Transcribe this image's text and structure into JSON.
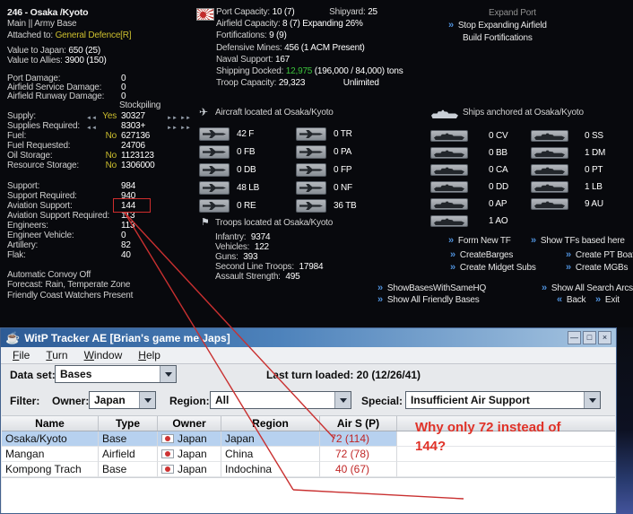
{
  "game": {
    "header": {
      "title": "246 - Osaka /Kyoto",
      "subtitle": "Main || Army Base",
      "attached_label": "Attached to:",
      "attached_value": "General Defence[R]",
      "value_japan_label": "Value to Japan:",
      "value_japan": "650 (25)",
      "value_allies_label": "Value to Allies:",
      "value_allies": "3900 (150)"
    },
    "damage": {
      "stockpiling_label": "Stockpiling",
      "rows": [
        {
          "label": "Port Damage:",
          "value": "0"
        },
        {
          "label": "Airfield Service Damage:",
          "value": "0"
        },
        {
          "label": "Airfield Runway Damage:",
          "value": "0"
        }
      ]
    },
    "supply": {
      "rows": [
        {
          "label": "Supply:",
          "flag": "Yes",
          "value": "30327"
        },
        {
          "label": "Supplies Required:",
          "flag": "",
          "value": "8303+"
        },
        {
          "label": "Fuel:",
          "flag": "No",
          "value": "627136"
        },
        {
          "label": "Fuel Requested:",
          "flag": "",
          "value": "24706"
        },
        {
          "label": "Oil Storage:",
          "flag": "No",
          "value": "1123123"
        },
        {
          "label": "Resource Storage:",
          "flag": "No",
          "value": "1306000"
        }
      ]
    },
    "support": {
      "rows": [
        {
          "label": "Support:",
          "value": "984"
        },
        {
          "label": "Support Required:",
          "value": "940"
        },
        {
          "label": "Aviation Support:",
          "value": "144"
        },
        {
          "label": "Aviation Support Required:",
          "value": "113"
        },
        {
          "label": "Engineers:",
          "value": "113"
        },
        {
          "label": "Engineer Vehicle:",
          "value": "0"
        },
        {
          "label": "Artillery:",
          "value": "82"
        },
        {
          "label": "Flak:",
          "value": "40"
        }
      ]
    },
    "footer_lines": [
      "Automatic Convoy Off",
      "Forecast: Rain, Temperate Zone",
      "Friendly Coast Watchers Present"
    ],
    "port": {
      "port_capacity_label": "Port Capacity:",
      "port_capacity": "10 (7)",
      "shipyard_label": "Shipyard:",
      "shipyard": "25",
      "airfield_label": "Airfield Capacity:",
      "airfield": "8 (7)",
      "airfield_expanding": "Expanding 26%",
      "fortifications_label": "Fortifications:",
      "fortifications": "9 (9)",
      "mines_label": "Defensive Mines:",
      "mines": "456 (1 ACM Present)",
      "naval_support_label": "Naval Support:",
      "naval_support": "167",
      "shipping_label": "Shipping Docked:",
      "shipping_tons": "12,975",
      "shipping_detail": "(196,000 / 84,000) tons",
      "troop_capacity_label": "Troop Capacity:",
      "troop_capacity": "29,323",
      "troop_capacity_note": "Unlimited"
    },
    "aircraft": {
      "header": "Aircraft located at Osaka/Kyoto",
      "rows": [
        {
          "left": "42 F",
          "right": "0 TR"
        },
        {
          "left": "0 FB",
          "right": "0 PA"
        },
        {
          "left": "0 DB",
          "right": "0 FP"
        },
        {
          "left": "48 LB",
          "right": "0 NF"
        },
        {
          "left": "0 RE",
          "right": "36 TB"
        }
      ]
    },
    "troops": {
      "header": "Troops located at Osaka/Kyoto",
      "rows": [
        {
          "label": "Infantry:",
          "value": "9374"
        },
        {
          "label": "Vehicles:",
          "value": "122"
        },
        {
          "label": "Guns:",
          "value": "393"
        },
        {
          "label": "Second Line Troops:",
          "value": "17984"
        },
        {
          "label": "Assault Strength:",
          "value": "495"
        }
      ]
    },
    "ships": {
      "header": "Ships anchored at Osaka/Kyoto",
      "left": [
        "0 CV",
        "0 BB",
        "0 CA",
        "0 DD",
        "0 AP",
        "1 AO"
      ],
      "right": [
        "0 SS",
        "1 DM",
        "0 PT",
        "1 LB",
        "9 AU"
      ]
    },
    "actions": {
      "expand_port": "Expand Port",
      "stop_expanding_airfield": "Stop Expanding Airfield",
      "build_fortifications": "Build Fortifications",
      "form_new_tf": "Form New TF",
      "show_tfs_based_here": "Show TFs based here",
      "create_barges": "CreateBarges",
      "create_pt_boats": "Create PT Boats",
      "create_midget_subs": "Create Midget Subs",
      "create_mgbs": "Create MGBs",
      "show_bases_with_same_hq": "ShowBasesWithSameHQ",
      "show_all_friendly_bases": "Show All Friendly Bases",
      "show_all_search_arcs": "Show All Search Arcs",
      "back": "Back",
      "exit": "Exit"
    }
  },
  "tracker": {
    "title": "WitP Tracker AE [Brian's game me Japs]",
    "menus": [
      "File",
      "Turn",
      "Window",
      "Help"
    ],
    "dataset_label": "Data set:",
    "dataset_value": "Bases",
    "last_turn": "Last turn loaded: 20 (12/26/41)",
    "filter_label": "Filter:",
    "owner_label": "Owner:",
    "owner_value": "Japan",
    "region_label": "Region:",
    "region_value": "All",
    "special_label": "Special:",
    "special_value": "Insufficient Air Support",
    "table": {
      "headers": [
        "Name",
        "Type",
        "Owner",
        "Region",
        "Air S (P)"
      ],
      "rows": [
        {
          "name": "Osaka/Kyoto",
          "type": "Base",
          "owner": "Japan",
          "region": "Japan",
          "air_s": "72 (114)"
        },
        {
          "name": "Mangan",
          "type": "Airfield",
          "owner": "Japan",
          "region": "China",
          "air_s": "72 (78)"
        },
        {
          "name": "Kompong Trach",
          "type": "Base",
          "owner": "Japan",
          "region": "Indochina",
          "air_s": "40 (67)"
        }
      ]
    }
  },
  "annotation": {
    "note": "Why only 72 instead of\n144?"
  },
  "icons": {
    "fwd": "»",
    "back": "«",
    "dec": "◄◄",
    "inc": "►►",
    "java": "☕",
    "minimize": "—",
    "maximize": "□",
    "close": "×",
    "troops_flag": "⚑",
    "aircraft": "✈"
  },
  "colors": {
    "highlight_red": "#cf2d2d",
    "yes_no_yellow": "#cdbf2e",
    "green": "#3cc43c",
    "selected_row": "#b7d1ef"
  }
}
